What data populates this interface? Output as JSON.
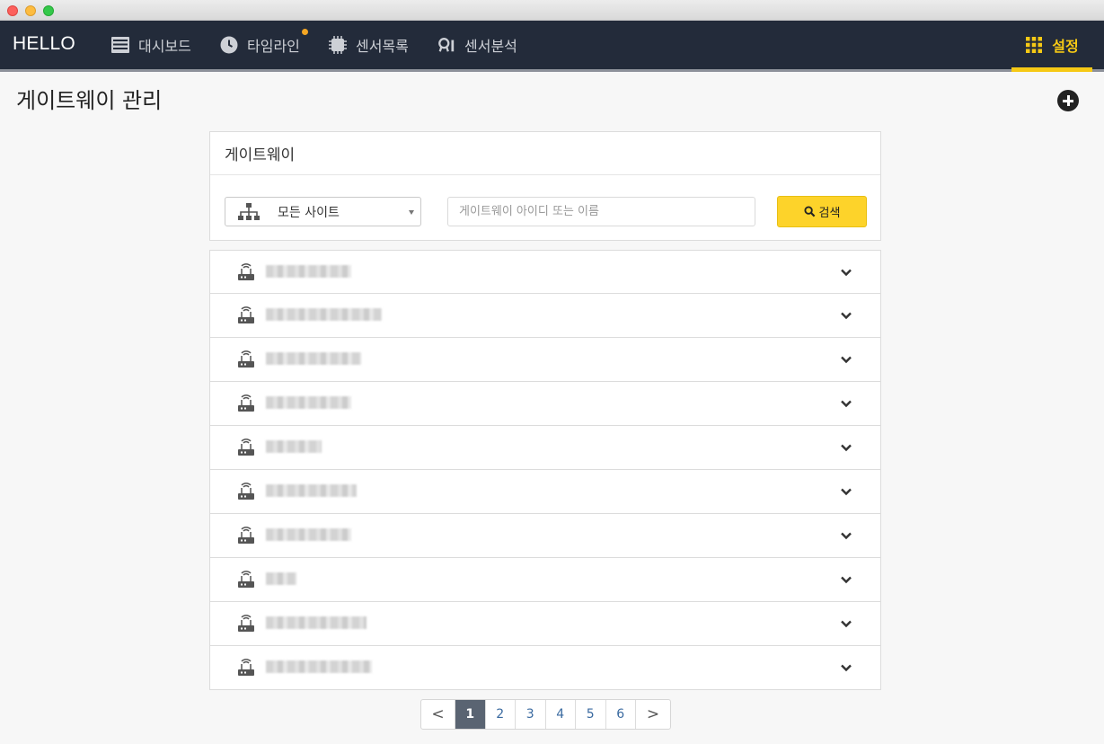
{
  "app": {
    "brand": "HELLO"
  },
  "nav": {
    "items": [
      {
        "label": "대시보드",
        "icon": "dashboard-icon"
      },
      {
        "label": "타임라인",
        "icon": "clock-icon",
        "has_badge": true
      },
      {
        "label": "센서목록",
        "icon": "chip-icon"
      },
      {
        "label": "센서분석",
        "icon": "analysis-icon"
      }
    ],
    "settings": {
      "label": "설정",
      "icon": "grid-icon",
      "active": true
    }
  },
  "page": {
    "title": "게이트웨이 관리",
    "add_icon": "plus-circle-icon"
  },
  "panel": {
    "title": "게이트웨이",
    "site_select": {
      "value": "모든 사이트",
      "icon": "sitemap-icon"
    },
    "search": {
      "placeholder": "게이트웨이 아이디 또는 이름",
      "value": ""
    },
    "search_button": {
      "label": "검색",
      "icon": "search-icon"
    }
  },
  "gateways": [
    {
      "name": "xxxxxxxxxxxxxxxxx"
    },
    {
      "name": "xxxxxxxxxxxxxxxxxxxxxxx"
    },
    {
      "name": "xxxxxxxxxxxxxxxxxxx"
    },
    {
      "name": "xxxxxxxxxxxxxxxxx"
    },
    {
      "name": "xxxxxxxxxxx"
    },
    {
      "name": "xxxxxxxxxxxxxxxxxx"
    },
    {
      "name": "xxxxxxxxxxxxxxxxx"
    },
    {
      "name": "xxxxxx"
    },
    {
      "name": "xxxxxxxxxxxxxxxxxxxx"
    },
    {
      "name": "xxxxxxxxxxxxxxxxxxxxx"
    }
  ],
  "pagination": {
    "prev": "<",
    "next": ">",
    "pages": [
      "1",
      "2",
      "3",
      "4",
      "5",
      "6"
    ],
    "current": "1"
  },
  "colors": {
    "nav_bg": "#232b3a",
    "accent": "#f6c915",
    "search_button": "#fdd32a",
    "active_page": "#5a6472"
  }
}
